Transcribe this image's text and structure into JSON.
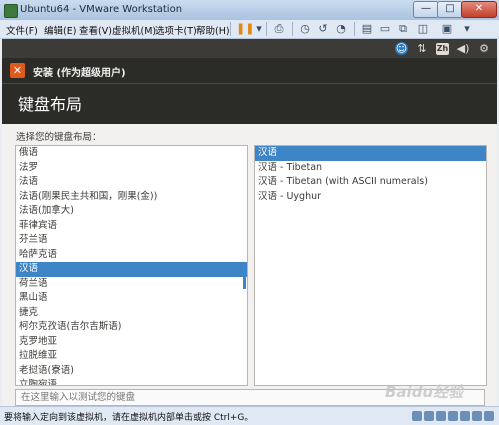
{
  "window": {
    "title": "Ubuntu64 - VMware Workstation",
    "min": "—",
    "max": "□",
    "close": "✕"
  },
  "menu": [
    "文件(F)",
    "编辑(E)",
    "查看(V)",
    "虚拟机(M)",
    "选项卡(T)",
    "帮助(H)"
  ],
  "toolbar_icons": [
    "pause-icon",
    "send-ctrl-alt-del-icon",
    "snapshot-icon",
    "revert-snapshot-icon",
    "snapshot-manager-icon",
    "view-console-icon",
    "fullscreen-icon",
    "unity-icon",
    "library-icon",
    "thumbnail-icon"
  ],
  "ubuntu_top": {
    "icons": [
      "accessibility-icon",
      "network-icon",
      "keyboard-layout-icon",
      "volume-icon",
      "power-icon"
    ],
    "keyboard_indicator": "Zh"
  },
  "installer": {
    "window_title": "安装 (作为超级用户)",
    "close_glyph": "✕",
    "page_title": "键盘布局",
    "prompt": "选择您的键盘布局：",
    "layouts": [
      "俄语",
      "法罗",
      "法语",
      "法语(刚果民主共和国，刚果(金))",
      "法语(加拿大)",
      "菲律宾语",
      "芬兰语",
      "哈萨克语",
      "汉语",
      "荷兰语",
      "黑山语",
      "捷克",
      "柯尔克孜语(吉尔吉斯语)",
      "克罗地亚",
      "拉脱维亚",
      "老挝语(寮语)",
      "立陶宛语"
    ],
    "selected_layout": "汉语",
    "variants": [
      "汉语",
      "汉语 - Tibetan",
      "汉语 - Tibetan (with ASCII numerals)",
      "汉语 - Uyghur"
    ],
    "selected_variant": "汉语",
    "test_placeholder": "在这里输入以测试您的键盘"
  },
  "status": {
    "text": "要将输入定向到该虚拟机，请在虚拟机内部单击或按 Ctrl+G。",
    "icons": [
      "hdd-icon",
      "cdrom-icon",
      "network-adapter-icon",
      "usb-icon",
      "sound-icon",
      "printer-icon",
      "display-icon"
    ]
  },
  "watermark": "Baidu经验",
  "colors": {
    "selection": "#3e85c7",
    "ubuntu_header": "#2b2b28",
    "close_button": "#e05a1e"
  }
}
